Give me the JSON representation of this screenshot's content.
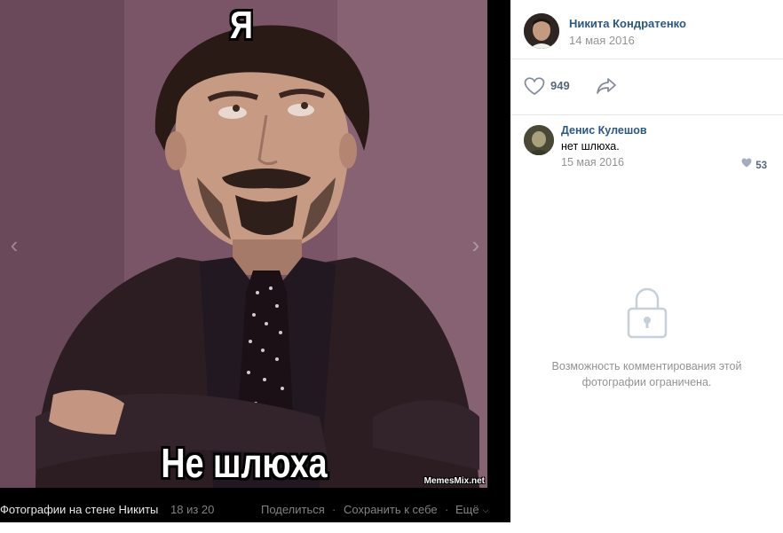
{
  "photo": {
    "meme_top_text": "Я",
    "meme_bottom_text": "Не шлюха",
    "watermark": "MemesMix.net"
  },
  "viewer_bottom": {
    "album": "Фотографии на стене Никиты",
    "counter": "18 из 20",
    "share_label": "Поделиться",
    "separator": "·",
    "save_label": "Сохранить к себе",
    "more_label": "Ещё"
  },
  "author": {
    "name": "Никита Кондратенко",
    "date": "14 мая 2016"
  },
  "actions": {
    "likes_count": "949"
  },
  "comments": [
    {
      "author": "Денис Кулешов",
      "text": "нет шлюха.",
      "date": "15 мая 2016",
      "likes": "53"
    }
  ],
  "restricted": {
    "line1": "Возможность комментирования этой",
    "line2": "фотографии ограничена."
  },
  "colors": {
    "link": "#2a5885",
    "muted": "#939393",
    "divider": "#e7e8ec",
    "icon": "#828a99"
  },
  "icons": {
    "like": "heart-outline-icon",
    "share": "share-arrow-icon",
    "lock": "lock-icon",
    "prev": "chevron-left-icon",
    "next": "chevron-right-icon"
  }
}
